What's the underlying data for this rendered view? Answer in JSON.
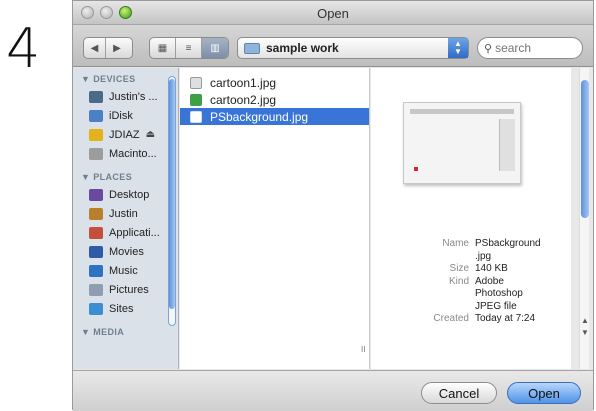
{
  "step": "4",
  "window": {
    "title": "Open"
  },
  "toolbar": {
    "back": "◀",
    "forward": "▶",
    "view_icons": "▦",
    "view_list": "≡",
    "view_columns": "▥",
    "location": "sample work",
    "search_placeholder": "search"
  },
  "sidebar": {
    "devices_header": "▼ DEVICES",
    "devices": [
      {
        "label": "Justin's ...",
        "icon": "computer-icon",
        "color": "#4a6a8c"
      },
      {
        "label": "iDisk",
        "icon": "idisk-icon",
        "color": "#4b7fc6"
      },
      {
        "label": "JDIAZ",
        "icon": "drive-icon",
        "color": "#e3b21d",
        "eject": "⏏"
      },
      {
        "label": "Macinto...",
        "icon": "hard-drive-icon",
        "color": "#9c9c9c"
      }
    ],
    "places_header": "▼ PLACES",
    "places": [
      {
        "label": "Desktop",
        "icon": "desktop-icon",
        "color": "#6a4aa0"
      },
      {
        "label": "Justin",
        "icon": "home-icon",
        "color": "#b9802c"
      },
      {
        "label": "Applicati...",
        "icon": "applications-icon",
        "color": "#c44f3a"
      },
      {
        "label": "Movies",
        "icon": "movies-icon",
        "color": "#2e5aa8"
      },
      {
        "label": "Music",
        "icon": "music-icon",
        "color": "#2f72c4"
      },
      {
        "label": "Pictures",
        "icon": "pictures-icon",
        "color": "#8f9db1"
      },
      {
        "label": "Sites",
        "icon": "sites-icon",
        "color": "#3a8fd0"
      }
    ],
    "media_header": "▼ MEDIA"
  },
  "files": [
    {
      "name": "cartoon1.jpg",
      "selected": false,
      "color": "#dfdfdf"
    },
    {
      "name": "cartoon2.jpg",
      "selected": false,
      "color": "#3f9f46"
    },
    {
      "name": "PSbackground.jpg",
      "selected": true,
      "color": "#ffffff"
    }
  ],
  "preview": {
    "name_key": "Name",
    "name_val": "PSbackground",
    "name_val2": ".jpg",
    "size_key": "Size",
    "size_val": "140 KB",
    "kind_key": "Kind",
    "kind_val": "Adobe",
    "kind_val2": "Photoshop",
    "kind_val3": "JPEG file",
    "created_key": "Created",
    "created_val": "Today at 7:24"
  },
  "buttons": {
    "cancel": "Cancel",
    "open": "Open"
  }
}
